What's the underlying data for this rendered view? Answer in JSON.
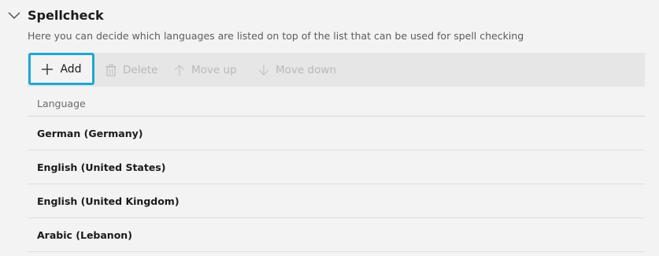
{
  "section": {
    "title": "Spellcheck",
    "description": "Here you can decide which languages are listed on top of the list that can be used for spell checking"
  },
  "toolbar": {
    "add_label": "Add",
    "delete_label": "Delete",
    "move_up_label": "Move up",
    "move_down_label": "Move down"
  },
  "table": {
    "column_header": "Language",
    "rows": [
      {
        "language": "German (Germany)"
      },
      {
        "language": "English (United States)"
      },
      {
        "language": "English (United Kingdom)"
      },
      {
        "language": "Arabic (Lebanon)"
      }
    ]
  },
  "colors": {
    "highlight": "#1ea7d6",
    "toolbar_bg": "#e6e6e6",
    "page_bg": "#f3f3f3"
  }
}
